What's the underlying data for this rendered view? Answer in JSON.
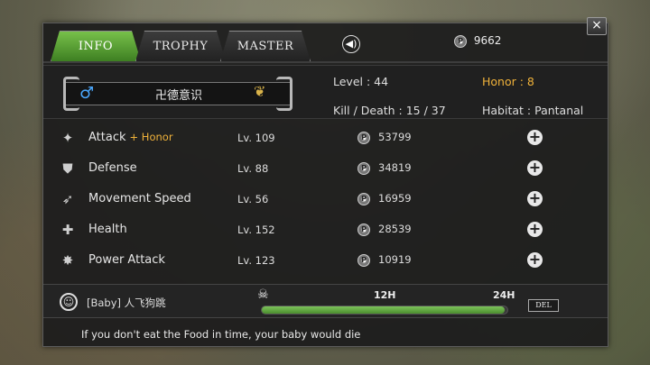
{
  "tabs": [
    {
      "label": "INFO",
      "active": true
    },
    {
      "label": "TROPHY",
      "active": false
    },
    {
      "label": "MASTER",
      "active": false
    }
  ],
  "header": {
    "close_label": "×",
    "sound_icon": "speaker-icon",
    "currency_symbol": "P",
    "currency": "9662"
  },
  "profile": {
    "gender_icon": "♂",
    "name": "卍德意识",
    "level": "Level : 44",
    "kill_death": "Kill / Death : 15 / 37",
    "honor": "Honor : 8",
    "habitat": "Habitat : Pantanal"
  },
  "stats": [
    {
      "icon": "claw-icon",
      "glyph": "✦",
      "name": "Attack",
      "bonus": "+ Honor",
      "level": "Lv. 109",
      "cost": "53799"
    },
    {
      "icon": "shield-icon",
      "glyph": "⛊",
      "name": "Defense",
      "bonus": "",
      "level": "Lv. 88",
      "cost": "34819"
    },
    {
      "icon": "wing-icon",
      "glyph": "➶",
      "name": "Movement Speed",
      "bonus": "",
      "level": "Lv. 56",
      "cost": "16959"
    },
    {
      "icon": "cross-icon",
      "glyph": "✚",
      "name": "Health",
      "bonus": "",
      "level": "Lv. 152",
      "cost": "28539"
    },
    {
      "icon": "burst-icon",
      "glyph": "✸",
      "name": "Power Attack",
      "bonus": "",
      "level": "Lv. 123",
      "cost": "10919"
    }
  ],
  "plus_label": "+",
  "baby": {
    "name": "[Baby] 人飞狗跳",
    "timer_icon": "skull-crossbones-icon",
    "mid_label": "12H",
    "end_label": "24H",
    "progress": 0.99,
    "del_label": "DEL"
  },
  "footer": "If you don't eat the Food in time, your baby would die",
  "colors": {
    "accent": "#5fae36",
    "honor": "#f0b23a",
    "male": "#4aa8ff"
  }
}
